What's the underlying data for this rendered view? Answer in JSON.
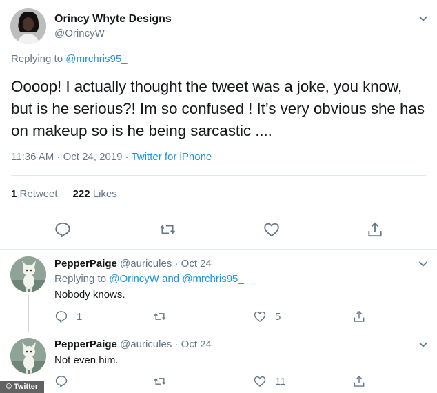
{
  "main_tweet": {
    "display_name": "Orincy Whyte Designs",
    "handle": "@OrincyW",
    "replying_label": "Replying to",
    "replying_to": "@mrchris95_",
    "text": "Oooop! I actually thought the tweet was a joke, you know, but is he serious?! Im so confused !  It’s very obvious she has on makeup so is he being sarcastic ....",
    "timestamp": "11:36 AM · Oct 24, 2019",
    "separator": " · ",
    "source": "Twitter for iPhone",
    "retweet_count": "1",
    "retweet_label": "Retweet",
    "like_count": "222",
    "like_label": "Likes"
  },
  "replies": [
    {
      "display_name": "PepperPaige",
      "handle": "@auricules",
      "date": "· Oct 24",
      "replying_label": "Replying to",
      "replying_to_1": "@OrincyW",
      "and_label": "and",
      "replying_to_2": "@mrchris95_",
      "text": "Nobody knows.",
      "reply_count": "1",
      "retweet_count": "",
      "like_count": "5"
    },
    {
      "display_name": "PepperPaige",
      "handle": "@auricules",
      "date": "· Oct 24",
      "text": "Not even him.",
      "reply_count": "",
      "retweet_count": "",
      "like_count": "11"
    }
  ],
  "watermark": "© Twitter",
  "colors": {
    "link": "#1b95e0",
    "muted": "#657786",
    "text": "#14171a",
    "divider": "#e1e8ed"
  },
  "icons": [
    "reply-icon",
    "retweet-icon",
    "like-icon",
    "share-icon",
    "chevron-down-icon"
  ]
}
